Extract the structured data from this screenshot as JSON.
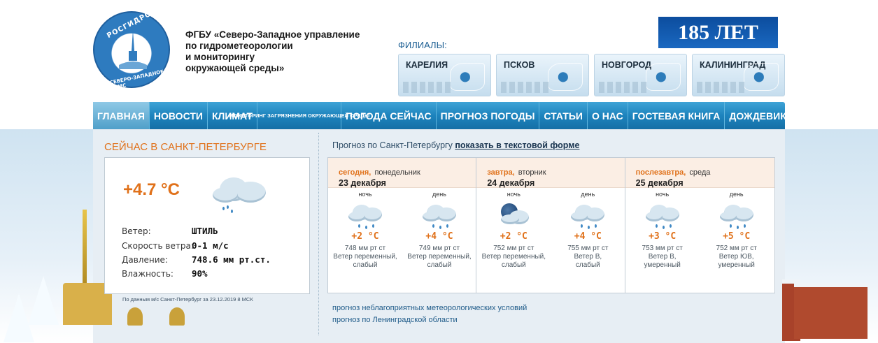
{
  "org": {
    "logo_top": "РОСГИДРОМЕТ",
    "logo_bottom": "СЕВЕРО-ЗАПАДНОЕ УГМС",
    "title_lines": [
      "ФГБУ «Северо-Западное управление",
      "по гидрометеорологии",
      "и мониторингу",
      "окружающей среды»"
    ]
  },
  "badge": "185 ЛЕТ",
  "branches": {
    "label": "ФИЛИАЛЫ:",
    "items": [
      "КАРЕЛИЯ",
      "ПСКОВ",
      "НОВГОРОД",
      "КАЛИНИНГРАД"
    ]
  },
  "nav": {
    "items": [
      "ГЛАВНАЯ",
      "НОВОСТИ",
      "КЛИМАТ",
      "МОНИТОРИНГ ЗАГРЯЗНЕНИЯ ОКРУЖАЮЩЕЙ СРЕДЫ",
      "ПОГОДА СЕЙЧАС",
      "ПРОГНОЗ ПОГОДЫ",
      "СТАТЬИ",
      "О НАС",
      "ГОСТЕВАЯ КНИГА",
      "ДОЖДЕВИК"
    ],
    "active": "ГЛАВНАЯ"
  },
  "now": {
    "title": "СЕЙЧАС В САНКТ-ПЕТЕРБУРГЕ",
    "temperature": "+4.7 °C",
    "icon": "cloud-rain-icon",
    "rows": [
      {
        "label": "Ветер:",
        "value": "ШТИЛЬ"
      },
      {
        "label": "Скорость ветра:",
        "value": "0-1 м/с"
      },
      {
        "label": "Давление:",
        "value": "748.6 мм рт.ст."
      },
      {
        "label": "Влажность:",
        "value": "90%"
      }
    ],
    "footnote": "По данным м/с Санкт-Петербург за 23.12.2019 8 МСК"
  },
  "forecast": {
    "header_text": "Прогноз по Санкт-Петербургу",
    "header_link": "показать в текстовой форме",
    "days": [
      {
        "rel": "сегодня,",
        "dow": "понедельник",
        "date": "23 декабря",
        "parts": [
          {
            "name": "ночь",
            "icon": "cloud-rain-icon",
            "temp": "+2 °C",
            "pressure": "748 мм рт ст",
            "wind1": "Ветер переменный,",
            "wind2": "слабый"
          },
          {
            "name": "день",
            "icon": "cloud-rain-icon",
            "temp": "+4 °C",
            "pressure": "749 мм рт ст",
            "wind1": "Ветер переменный,",
            "wind2": "слабый"
          }
        ]
      },
      {
        "rel": "завтра,",
        "dow": "вторник",
        "date": "24 декабря",
        "parts": [
          {
            "name": "ночь",
            "icon": "moon-cloud-icon",
            "temp": "+2 °C",
            "pressure": "752 мм рт ст",
            "wind1": "Ветер переменный,",
            "wind2": "слабый"
          },
          {
            "name": "день",
            "icon": "cloud-rain-icon",
            "temp": "+4 °C",
            "pressure": "755 мм рт ст",
            "wind1": "Ветер В,",
            "wind2": "слабый"
          }
        ]
      },
      {
        "rel": "послезавтра,",
        "dow": "среда",
        "date": "25 декабря",
        "parts": [
          {
            "name": "ночь",
            "icon": "cloud-rain-icon",
            "temp": "+3 °C",
            "pressure": "753 мм рт ст",
            "wind1": "Ветер В,",
            "wind2": "умеренный"
          },
          {
            "name": "день",
            "icon": "cloud-rain-icon",
            "temp": "+5 °C",
            "pressure": "752 мм рт ст",
            "wind1": "Ветер ЮВ,",
            "wind2": "умеренный"
          }
        ]
      }
    ],
    "links": [
      "прогноз неблагоприятных метеорологических условий",
      "прогноз по Ленинградской области"
    ]
  },
  "colors": {
    "accent": "#e0711a",
    "nav": "#1d83bd",
    "badge": "#0c4d9e"
  }
}
